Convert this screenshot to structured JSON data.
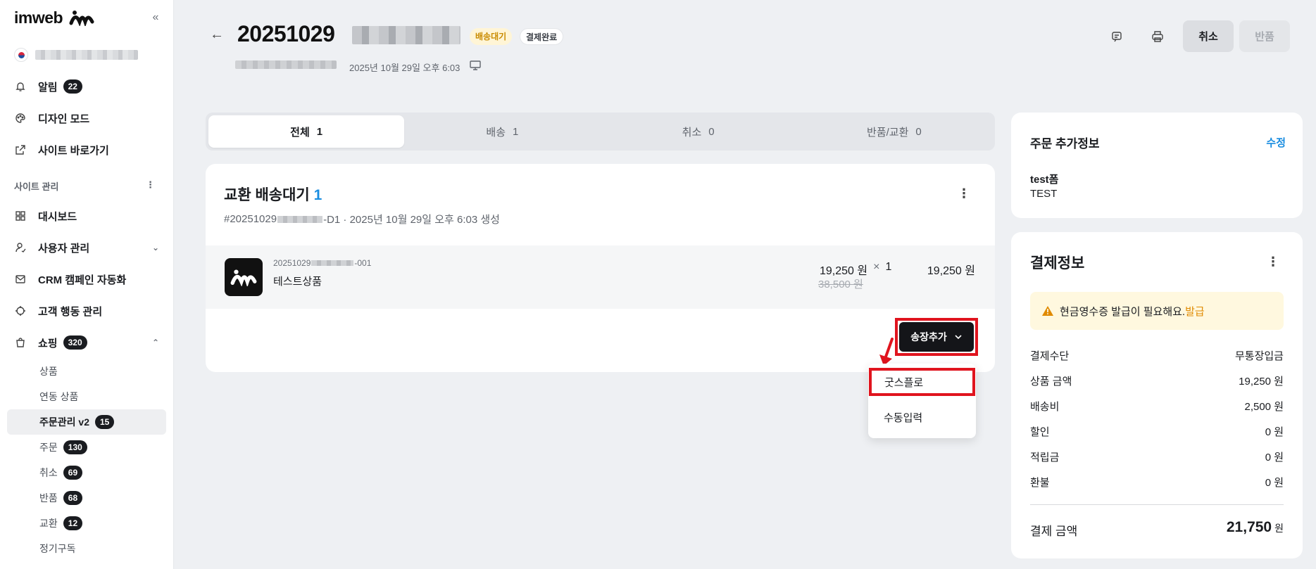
{
  "sidebar": {
    "logo": "imweb",
    "nav_top": [
      {
        "label": "알림",
        "badge": "22",
        "icon": "bell-icon"
      },
      {
        "label": "디자인 모드",
        "icon": "palette-icon"
      },
      {
        "label": "사이트 바로가기",
        "icon": "external-link-icon"
      }
    ],
    "section_label": "사이트 관리",
    "nav_main": [
      {
        "label": "대시보드",
        "icon": "grid-icon"
      },
      {
        "label": "사용자 관리",
        "icon": "user-icon"
      },
      {
        "label": "CRM 캠페인 자동화",
        "icon": "mail-icon"
      },
      {
        "label": "고객 행동 관리",
        "icon": "target-icon"
      },
      {
        "label": "쇼핑",
        "badge": "320",
        "icon": "bag-icon"
      }
    ],
    "sub_items": [
      {
        "label": "상품"
      },
      {
        "label": "연동 상품"
      },
      {
        "label": "주문관리 v2",
        "badge": "15"
      },
      {
        "label": "주문",
        "badge": "130"
      },
      {
        "label": "취소",
        "badge": "69"
      },
      {
        "label": "반품",
        "badge": "68"
      },
      {
        "label": "교환",
        "badge": "12"
      },
      {
        "label": "정기구독"
      }
    ]
  },
  "header": {
    "order_number": "20251029",
    "status_wait": "배송대기",
    "status_paid": "결제완료",
    "order_date": "2025년 10월 29일 오후 6:03",
    "cancel_label": "취소",
    "return_label": "반품"
  },
  "tabs": [
    {
      "label": "전체",
      "count": "1"
    },
    {
      "label": "배송",
      "count": "1"
    },
    {
      "label": "취소",
      "count": "0"
    },
    {
      "label": "반품/교환",
      "count": "0"
    }
  ],
  "exchange": {
    "title": "교환 배송대기",
    "count": "1",
    "meta_prefix": "#20251029",
    "meta_suffix": "-D1 · 2025년 10월 29일 오후 6:03 생성",
    "item": {
      "code_prefix": "20251029",
      "code_suffix": "-001",
      "name": "테스트상품",
      "unit_price": "19,250 원",
      "times": "×",
      "qty": "1",
      "orig_price": "38,500 원",
      "total": "19,250 원"
    },
    "add_invoice_label": "송장추가",
    "dropdown": [
      "굿스플로",
      "수동입력"
    ]
  },
  "extra_info": {
    "title": "주문 추가정보",
    "edit_label": "수정",
    "field_label": "test폼",
    "field_value": "TEST"
  },
  "payment": {
    "title": "결제정보",
    "notice_text": "현금영수증 발급이 필요해요.",
    "notice_link": "발급",
    "rows": [
      {
        "label": "결제수단",
        "value": "무통장입금"
      },
      {
        "label": "상품 금액",
        "value": "19,250 원"
      },
      {
        "label": "배송비",
        "value": "2,500 원"
      },
      {
        "label": "할인",
        "value": "0 원"
      },
      {
        "label": "적립금",
        "value": "0 원"
      },
      {
        "label": "환불",
        "value": "0 원"
      }
    ],
    "total_label": "결제 금액",
    "total_value": "21,750",
    "total_unit": "원"
  },
  "colors": {
    "accent_blue": "#1a8de0",
    "annotation_red": "#e0141e",
    "notice_orange": "#e08a00"
  }
}
